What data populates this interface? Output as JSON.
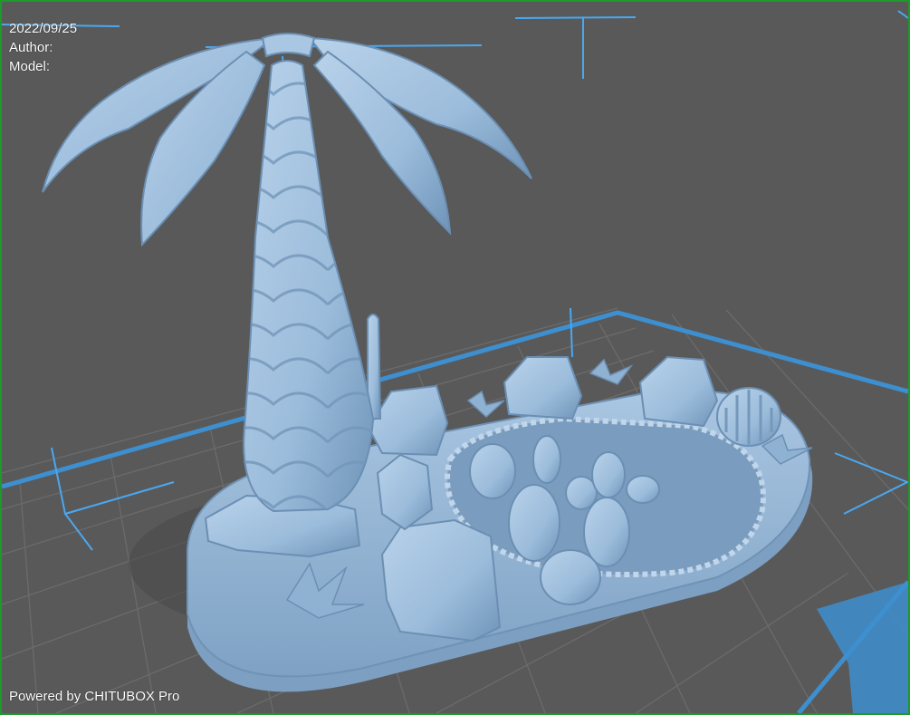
{
  "app": {
    "name": "CHITUBOX Pro",
    "powered_by": "Powered by CHITUBOX Pro"
  },
  "model_info": {
    "date": "2022/09/25",
    "author_label": "Author:",
    "model_label": "Model:"
  },
  "colors": {
    "background": "#595959",
    "border": "#1d9a2a",
    "grid_line": "#6a6a6a",
    "build_plate_edge": "#3d8fd0",
    "bounding_box": "#4aa8f0",
    "model": "#9fbfdc",
    "text": "#ffffff"
  }
}
